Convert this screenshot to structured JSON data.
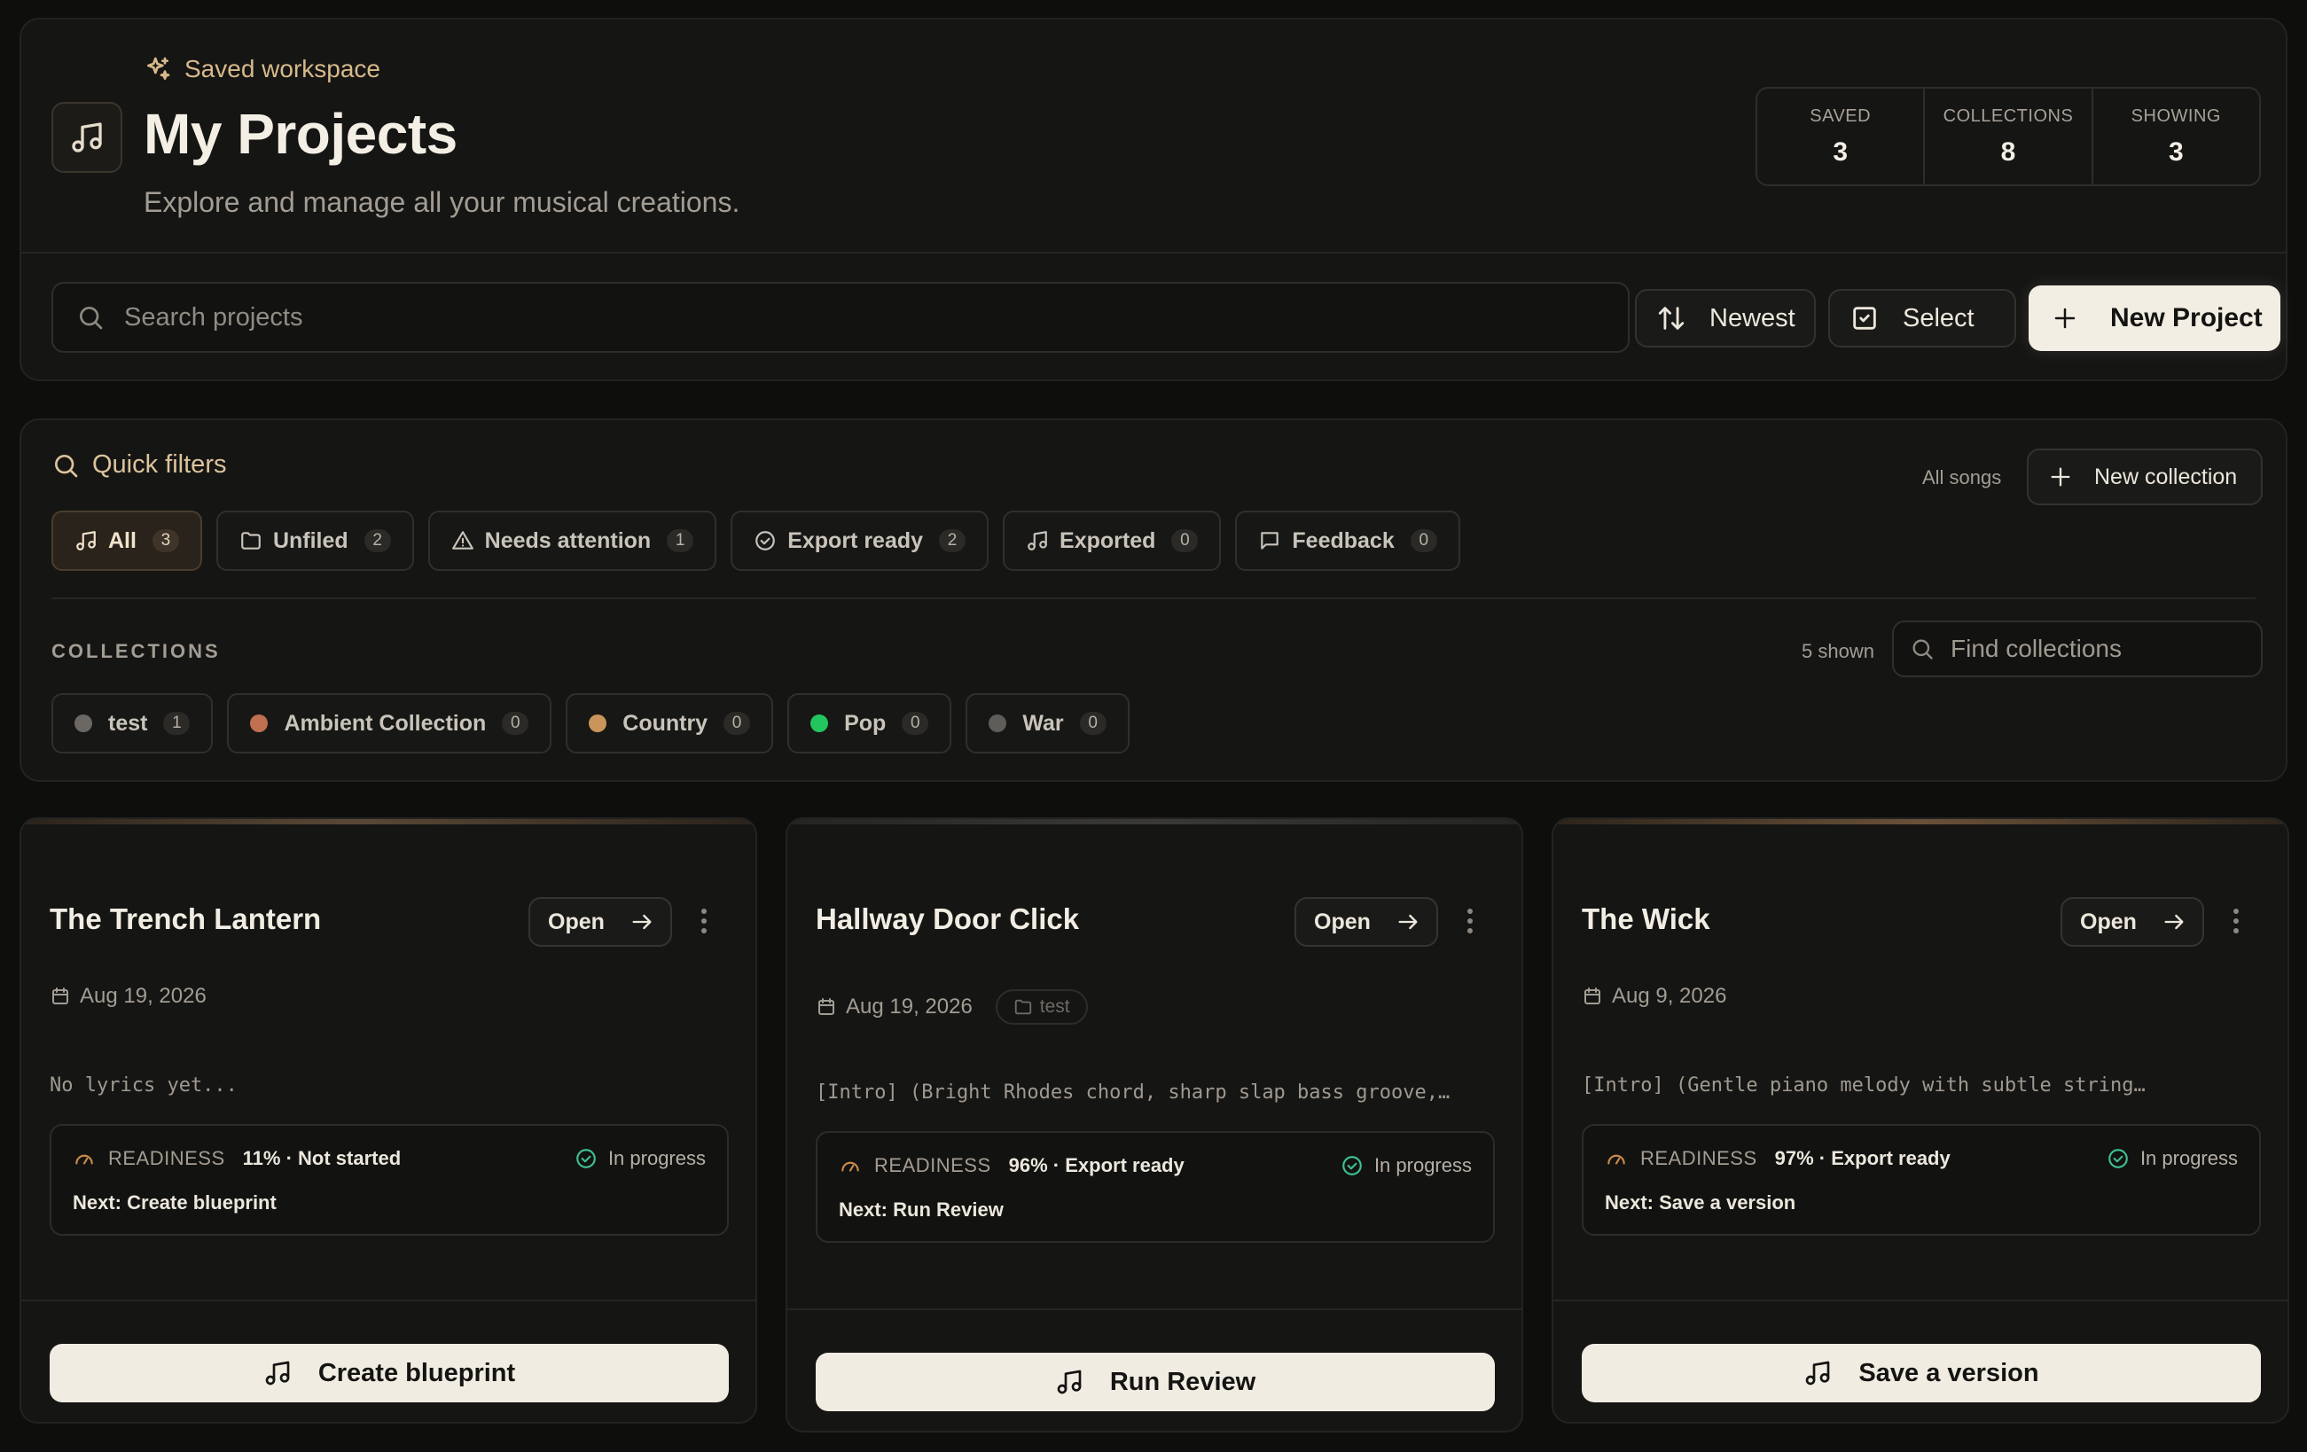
{
  "header": {
    "eyebrow": "Saved workspace",
    "title": "My Projects",
    "subtitle": "Explore and manage all your musical creations.",
    "stats": [
      {
        "label": "SAVED",
        "value": "3"
      },
      {
        "label": "COLLECTIONS",
        "value": "8"
      },
      {
        "label": "SHOWING",
        "value": "3"
      }
    ]
  },
  "toolbar": {
    "search_placeholder": "Search projects",
    "sort_label": "Newest",
    "select_label": "Select",
    "new_project_label": "New Project"
  },
  "filters": {
    "title": "Quick filters",
    "all_songs_label": "All songs",
    "new_collection_label": "New collection",
    "items": [
      {
        "label": "All",
        "count": "3",
        "icon": "music-note-icon",
        "active": true
      },
      {
        "label": "Unfiled",
        "count": "2",
        "icon": "folder-icon"
      },
      {
        "label": "Needs attention",
        "count": "1",
        "icon": "warning-icon"
      },
      {
        "label": "Export ready",
        "count": "2",
        "icon": "check-circle-icon"
      },
      {
        "label": "Exported",
        "count": "0",
        "icon": "music-note-icon"
      },
      {
        "label": "Feedback",
        "count": "0",
        "icon": "message-icon"
      }
    ]
  },
  "collections": {
    "label": "COLLECTIONS",
    "shown": "5 shown",
    "search_placeholder": "Find collections",
    "items": [
      {
        "label": "test",
        "count": "1",
        "color": "#6b6864"
      },
      {
        "label": "Ambient Collection",
        "count": "0",
        "color": "#c0704f"
      },
      {
        "label": "Country",
        "count": "0",
        "color": "#c9955b"
      },
      {
        "label": "Pop",
        "count": "0",
        "color": "#22c55e"
      },
      {
        "label": "War",
        "count": "0",
        "color": "#5f5d5a"
      }
    ]
  },
  "projects": [
    {
      "title": "The Trench Lantern",
      "open_label": "Open",
      "date": "Aug 19, 2026",
      "lyrics": "No lyrics yet...",
      "readiness_label": "READINESS",
      "readiness_value": "11% · Not started",
      "status": "In progress",
      "next": "Next: Create blueprint",
      "action": "Create blueprint",
      "accent": "#5a4835"
    },
    {
      "title": "Hallway Door Click",
      "open_label": "Open",
      "date": "Aug 19, 2026",
      "collection_tag": "test",
      "lyrics": "[Intro] (Bright Rhodes chord, sharp slap bass groove,…",
      "readiness_label": "READINESS",
      "readiness_value": "96% · Export ready",
      "status": "In progress",
      "next": "Next: Run Review",
      "action": "Run Review",
      "accent": "#3a3936"
    },
    {
      "title": "The Wick",
      "open_label": "Open",
      "date": "Aug 9, 2026",
      "lyrics": "[Intro] (Gentle piano melody with subtle string…",
      "readiness_label": "READINESS",
      "readiness_value": "97% · Export ready",
      "status": "In progress",
      "next": "Next: Save a version",
      "action": "Save a version",
      "accent": "#6a5138"
    }
  ],
  "colors": {
    "accent_gold": "#d8b98a",
    "status_green": "#3fbf8f",
    "readiness_orange": "#c98a4a",
    "background": "#0e0e0d"
  }
}
